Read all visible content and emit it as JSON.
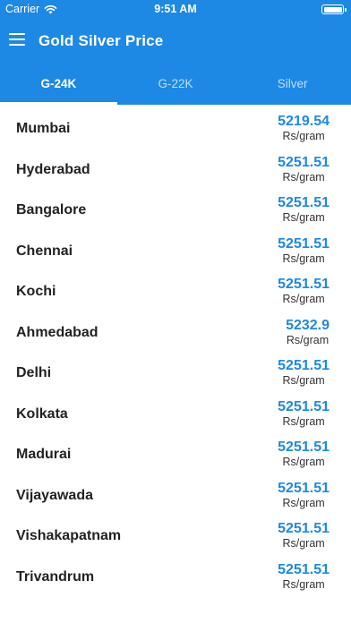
{
  "status_bar": {
    "carrier": "Carrier",
    "time": "9:51 AM",
    "icons": [
      "wifi-icon",
      "battery-icon"
    ]
  },
  "app_bar": {
    "title": "Gold Silver Price",
    "icon": "menu-icon"
  },
  "tabs": [
    {
      "label": "G-24K",
      "active": true
    },
    {
      "label": "G-22K",
      "active": false
    },
    {
      "label": "Silver",
      "active": false
    }
  ],
  "prices": [
    {
      "city": "Mumbai",
      "value": "5219.54",
      "unit": "Rs/gram"
    },
    {
      "city": "Hyderabad",
      "value": "5251.51",
      "unit": "Rs/gram"
    },
    {
      "city": "Bangalore",
      "value": "5251.51",
      "unit": "Rs/gram"
    },
    {
      "city": "Chennai",
      "value": "5251.51",
      "unit": "Rs/gram"
    },
    {
      "city": "Kochi",
      "value": "5251.51",
      "unit": "Rs/gram"
    },
    {
      "city": "Ahmedabad",
      "value": "5232.9",
      "unit": "Rs/gram"
    },
    {
      "city": "Delhi",
      "value": "5251.51",
      "unit": "Rs/gram"
    },
    {
      "city": "Kolkata",
      "value": "5251.51",
      "unit": "Rs/gram"
    },
    {
      "city": "Madurai",
      "value": "5251.51",
      "unit": "Rs/gram"
    },
    {
      "city": "Vijayawada",
      "value": "5251.51",
      "unit": "Rs/gram"
    },
    {
      "city": "Vishakapatnam",
      "value": "5251.51",
      "unit": "Rs/gram"
    },
    {
      "city": "Trivandrum",
      "value": "5251.51",
      "unit": "Rs/gram"
    }
  ],
  "colors": {
    "primary": "#1e88e5",
    "price_text": "#1e88e5",
    "city_text": "#222222",
    "background": "#ffffff"
  }
}
